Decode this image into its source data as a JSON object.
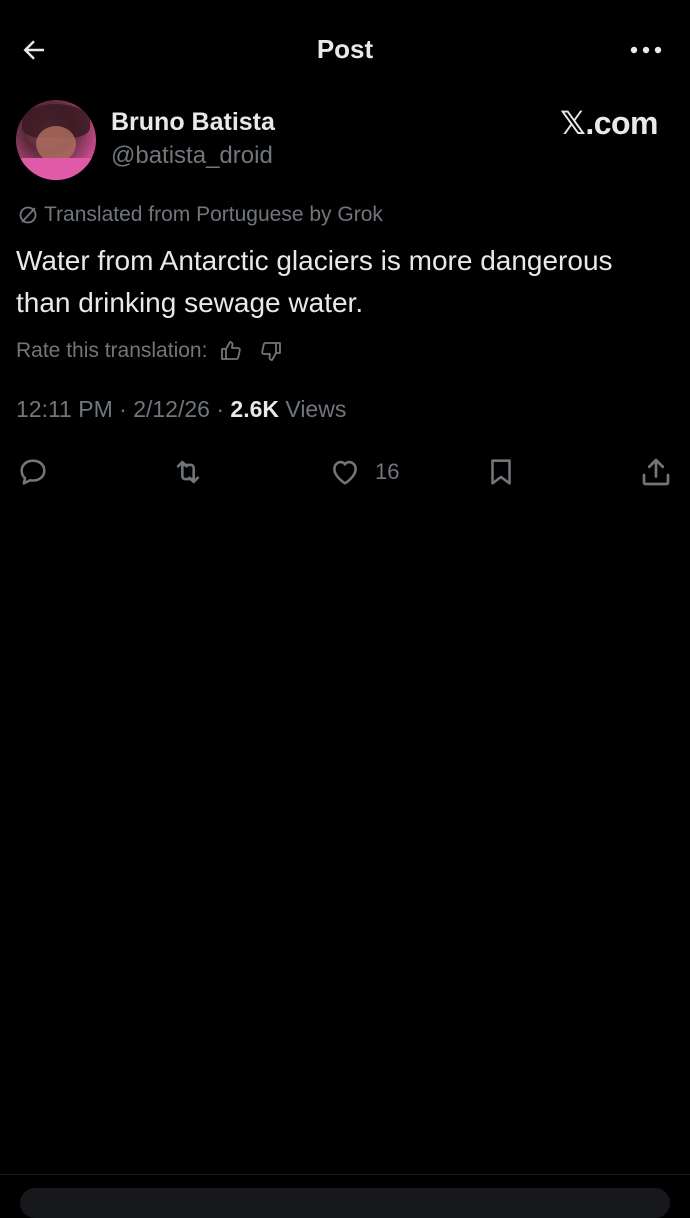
{
  "header": {
    "title": "Post",
    "back_icon": "arrow-left-icon",
    "more_icon": "more-horizontal-icon"
  },
  "author": {
    "name": "Bruno Batista",
    "handle": "@batista_droid"
  },
  "watermark": "𝕏.com",
  "translation": {
    "notice": "Translated from Portuguese by Grok",
    "rate_label": "Rate this translation:"
  },
  "post": {
    "text": "Water from Antarctic glaciers is more dangerous than drinking sewage water."
  },
  "meta": {
    "time": "12:11 PM",
    "date": "2/12/26",
    "views_count": "2.6K",
    "views_label": "Views"
  },
  "actions": {
    "like_count": "16"
  },
  "colors": {
    "background": "#000000",
    "text_primary": "#e7e9ea",
    "text_secondary": "#71767b"
  }
}
